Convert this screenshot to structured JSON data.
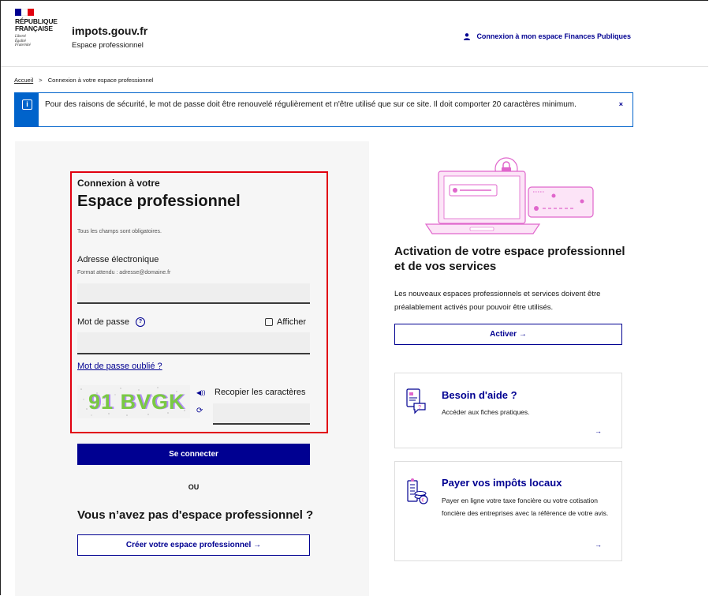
{
  "header": {
    "republic_title_line1": "RÉPUBLIQUE",
    "republic_title_line2": "FRANÇAISE",
    "motto_line1": "Liberté",
    "motto_line2": "Égalité",
    "motto_line3": "Fraternité",
    "site_title": "impots.gouv.fr",
    "site_subtitle": "Espace professionnel",
    "login_link": "Connexion à mon espace Finances Publiques"
  },
  "breadcrumb": {
    "home": "Accueil",
    "separator": ">",
    "current": "Connexion à votre espace professionnel"
  },
  "alert": {
    "text": "Pour des raisons de sécurité, le mot de passe doit être renouvelé régulièrement et n'être utilisé que sur ce site. Il doit comporter 20 caractères minimum.",
    "close": "×"
  },
  "login": {
    "title_small": "Connexion à votre",
    "title_big": "Espace professionnel",
    "required_note": "Tous les champs sont obligatoires.",
    "email_label": "Adresse électronique",
    "email_hint": "Format attendu : adresse@domaine.fr",
    "email_value": "",
    "password_label": "Mot de passe",
    "password_value": "",
    "show_password": "Afficher",
    "forgot_password": "Mot de passe oublié ?",
    "captcha_image_text": "91 BVGK",
    "captcha_label": "Recopier les caractères",
    "captcha_value": "",
    "submit": "Se connecter",
    "or": "OU",
    "no_account": "Vous n’avez pas d'espace professionnel ?",
    "create_account": "Créer votre espace professionnel →"
  },
  "activation": {
    "title": "Activation de votre espace professionnel et de vos services",
    "text": "Les nouveaux espaces professionnels et services doivent être préalablement activés pour pouvoir être utilisés.",
    "button": "Activer →"
  },
  "cards": [
    {
      "icon": "help-document-icon",
      "title": "Besoin d'aide ?",
      "text": "Accéder aux fiches pratiques.",
      "arrow": "→"
    },
    {
      "icon": "coins-payment-icon",
      "title": "Payer vos impôts locaux",
      "text": "Payer en ligne votre taxe foncière ou votre cotisation foncière des entreprises avec la référence de votre avis.",
      "arrow": "→"
    }
  ],
  "colors": {
    "primary": "#000091",
    "alert_blue": "#0063cb",
    "highlight_red": "#e1000f",
    "illustration_pink": "#e066cc",
    "flag_red": "#e1000f"
  }
}
